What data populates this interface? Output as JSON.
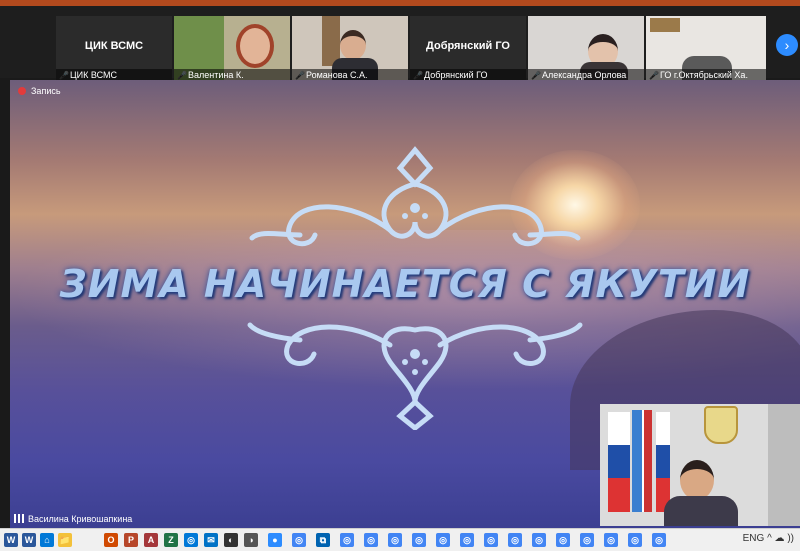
{
  "participants": [
    {
      "big": "ЦИК ВСМС",
      "label": "ЦИК ВСМС",
      "video": false
    },
    {
      "big": "",
      "label": "Валентина К.",
      "video": true
    },
    {
      "big": "",
      "label": "Романова С.А.",
      "video": true
    },
    {
      "big": "Добрянский ГО",
      "label": "Добрянский ГО",
      "video": false
    },
    {
      "big": "",
      "label": "Александра Орлова",
      "video": true
    },
    {
      "big": "",
      "label": "ГО г.Октябрьский Ха.",
      "video": true
    }
  ],
  "recording_label": "Запись",
  "stage": {
    "title": "ЗИМА НАЧИНАЕТСЯ С ЯКУТИИ",
    "speaker": "Василина Кривошапкина"
  },
  "icons": {
    "mic_muted": "mic-muted-icon",
    "next": "chevron-right-icon"
  },
  "taskbar": {
    "apps": [
      "W",
      "W",
      "⌂",
      "📁",
      "O",
      "P",
      "A",
      "Z",
      "◎",
      "✉",
      "◐",
      "◑",
      "●",
      "◎",
      "⧉",
      "◎",
      "◎",
      "◎",
      "◎",
      "◎",
      "◎",
      "◎",
      "◎",
      "◎",
      "◎",
      "◎",
      "◎",
      "◎",
      "◎"
    ],
    "tray": "ENG  ^  ☁  ))"
  }
}
